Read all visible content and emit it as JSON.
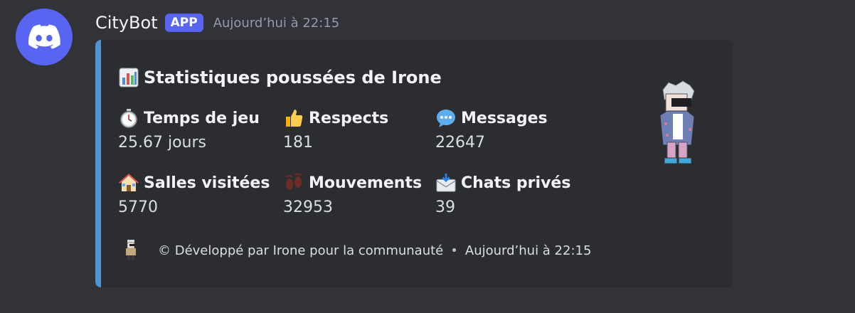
{
  "message": {
    "author": "CityBot",
    "badge": "APP",
    "timestamp": "Aujourd’hui à 22:15"
  },
  "embed": {
    "accent_color": "#4f95d6",
    "title": "Statistiques poussées de Irone",
    "title_icon": "bar-chart-emoji",
    "fields": [
      {
        "name": "Temps de jeu",
        "value": "25.67 jours",
        "icon": "stopwatch-emoji"
      },
      {
        "name": "Respects",
        "value": "181",
        "icon": "thumbs-up-emoji"
      },
      {
        "name": "Messages",
        "value": "22647",
        "icon": "speech-balloon-emoji"
      },
      {
        "name": "Salles visitées",
        "value": "5770",
        "icon": "house-emoji"
      },
      {
        "name": "Mouvements",
        "value": "32953",
        "icon": "footprints-emoji"
      },
      {
        "name": "Chats privés",
        "value": "39",
        "icon": "inbox-envelope-emoji"
      }
    ],
    "footer": {
      "text": "© Développé par Irone pour la communauté",
      "separator": "•",
      "timestamp": "Aujourd’hui à 22:15"
    }
  },
  "colors": {
    "background": "#323339",
    "embed_bg": "#2b2d31",
    "blurple": "#5865f2"
  }
}
